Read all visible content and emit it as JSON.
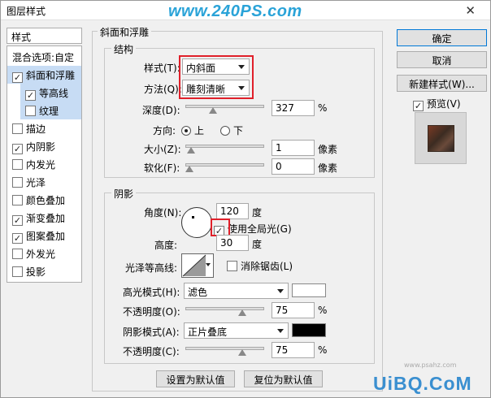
{
  "window": {
    "title": "图层样式",
    "watermark": "www.240PS.com",
    "close": "✕"
  },
  "styles_panel": {
    "header": "样式",
    "blend_options": "混合选项:自定",
    "items": [
      {
        "label": "斜面和浮雕",
        "checked": true,
        "selected": true,
        "sub": false
      },
      {
        "label": "等高线",
        "checked": true,
        "selected": true,
        "sub": true
      },
      {
        "label": "纹理",
        "checked": false,
        "selected": true,
        "sub": true
      },
      {
        "label": "描边",
        "checked": false,
        "selected": false,
        "sub": false
      },
      {
        "label": "内阴影",
        "checked": true,
        "selected": false,
        "sub": false
      },
      {
        "label": "内发光",
        "checked": false,
        "selected": false,
        "sub": false
      },
      {
        "label": "光泽",
        "checked": false,
        "selected": false,
        "sub": false
      },
      {
        "label": "颜色叠加",
        "checked": false,
        "selected": false,
        "sub": false
      },
      {
        "label": "渐变叠加",
        "checked": true,
        "selected": false,
        "sub": false
      },
      {
        "label": "图案叠加",
        "checked": true,
        "selected": false,
        "sub": false
      },
      {
        "label": "外发光",
        "checked": false,
        "selected": false,
        "sub": false
      },
      {
        "label": "投影",
        "checked": false,
        "selected": false,
        "sub": false
      }
    ]
  },
  "bevel": {
    "group_title": "斜面和浮雕",
    "structure_title": "结构",
    "style_label": "样式(T):",
    "style_value": "内斜面",
    "technique_label": "方法(Q):",
    "technique_value": "雕刻清晰",
    "depth_label": "深度(D):",
    "depth_value": "327",
    "depth_unit": "%",
    "depth_level": 0.33,
    "direction_label": "方向:",
    "direction_up": "上",
    "direction_down": "下",
    "size_label": "大小(Z):",
    "size_value": "1",
    "size_unit": "像素",
    "size_level": 0.02,
    "soften_label": "软化(F):",
    "soften_value": "0",
    "soften_unit": "像素",
    "soften_level": 0.0
  },
  "shading": {
    "title": "阴影",
    "angle_label": "角度(N):",
    "angle_value": "120",
    "angle_unit": "度",
    "global_light_label": "使用全局光(G)",
    "altitude_label": "高度:",
    "altitude_value": "30",
    "altitude_unit": "度",
    "gloss_label": "光泽等高线:",
    "antialias_label": "消除锯齿(L)",
    "highlight_mode_label": "高光模式(H):",
    "highlight_mode_value": "滤色",
    "highlight_color": "#ffffff",
    "highlight_opacity_label": "不透明度(O):",
    "highlight_opacity_value": "75",
    "highlight_opacity_unit": "%",
    "highlight_opacity_level": 0.75,
    "shadow_mode_label": "阴影模式(A):",
    "shadow_mode_value": "正片叠底",
    "shadow_color": "#000000",
    "shadow_opacity_label": "不透明度(C):",
    "shadow_opacity_value": "75",
    "shadow_opacity_unit": "%",
    "shadow_opacity_level": 0.75
  },
  "buttons": {
    "set_default": "设置为默认值",
    "reset_default": "复位为默认值",
    "ok": "确定",
    "cancel": "取消",
    "new_style": "新建样式(W)...",
    "preview": "预览(V)"
  },
  "footer_watermark": "UiBQ.CoM",
  "footer_small": "www.psahz.com"
}
